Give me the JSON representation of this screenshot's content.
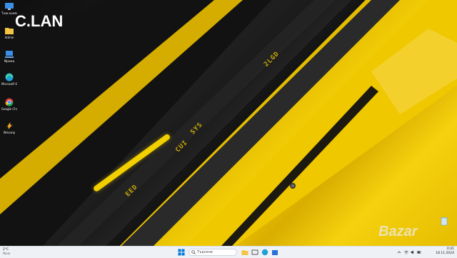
{
  "desktop": {
    "overlay_text": "C.LAN",
    "watermark": "Bazar",
    "icons": [
      {
        "name": "this-pc-icon",
        "label": "Този компютър"
      },
      {
        "name": "folder-icon",
        "label": "Admin"
      },
      {
        "name": "network-icon",
        "label": "Мрежа"
      },
      {
        "name": "edge-icon",
        "label": "Microsoft Edge"
      },
      {
        "name": "chrome-icon",
        "label": "Google Chrome"
      },
      {
        "name": "winamp-icon",
        "label": "Winamp"
      }
    ],
    "wallpaper_text": [
      "CUI",
      "SYS",
      "EED",
      "2LGD"
    ],
    "colors": {
      "yellow": "#f2cd06",
      "dark": "#161616"
    }
  },
  "taskbar": {
    "weather": {
      "temp": "2°C",
      "desc": "Ясно"
    },
    "search_placeholder": "Търсене",
    "pinned": [
      "start-icon",
      "search-icon",
      "file-explorer-icon",
      "edge-icon",
      "chrome-icon",
      "store-icon"
    ],
    "clock": {
      "time": "0:41",
      "date": "18.11.2024"
    }
  }
}
